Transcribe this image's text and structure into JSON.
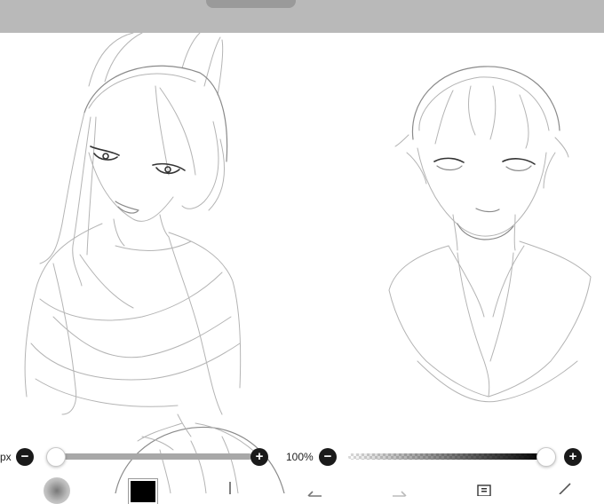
{
  "brush_size": {
    "value_text": "px",
    "minus_label": "−",
    "plus_label": "+",
    "level": 0.0
  },
  "opacity": {
    "value_text": "100%",
    "minus_label": "−",
    "plus_label": "+",
    "level": 1.0
  },
  "toolbar": {
    "color": "#000000",
    "icons": [
      "brush-preview-icon",
      "color-swatch",
      "transform-icon",
      "undo-icon",
      "redo-icon",
      "layers-icon",
      "close-icon"
    ]
  }
}
